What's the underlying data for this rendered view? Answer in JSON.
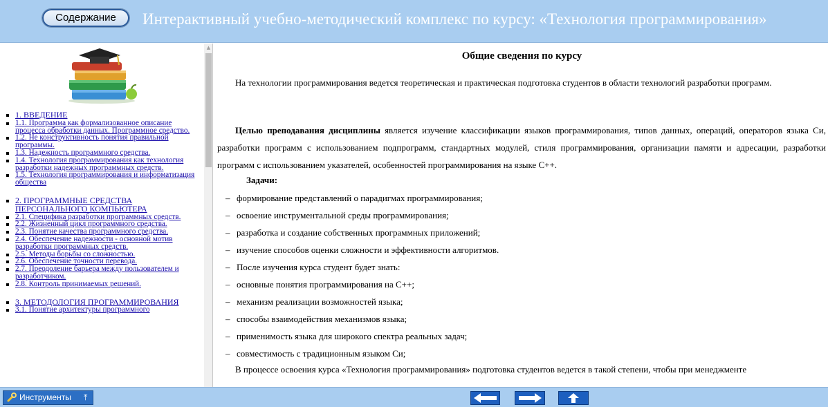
{
  "header": {
    "toc_button": "Содержание",
    "title": "Интерактивный учебно-методический комплекс по курсу: «Технология программирования»"
  },
  "sidebar": {
    "logo_icon": "books-graduation-cap-icon",
    "items": [
      {
        "label": "1. ВВЕДЕНИЕ",
        "kind": "part"
      },
      {
        "label": "1.1. Программа как формализованное описание процесса обработки данных. Программное средство."
      },
      {
        "label": "1.2. Не конструктивность понятия правильной программы."
      },
      {
        "label": "1.3. Надежность программного средства."
      },
      {
        "label": "1.4. Технология программирования как технология разработки надежных программных средств."
      },
      {
        "label": "1.5. Технология программирования и информатизация общества"
      },
      {
        "label": "2. ПРОГРАММНЫЕ СРЕДСТВА ПЕРСОНАЛЬНОГО КОМПЬЮТЕРА",
        "kind": "part"
      },
      {
        "label": "2.1. Специфика разработки программных средств."
      },
      {
        "label": "2.2. Жизненный цикл программного средства."
      },
      {
        "label": "2.3. Понятие качества программного средства."
      },
      {
        "label": "2.4. Обеспечение надежности - основной мотив разработки программных средств."
      },
      {
        "label": "2.5. Методы борьбы со сложностью."
      },
      {
        "label": "2.6. Обеспечение точности перевода."
      },
      {
        "label": "2.7. Преодоление барьера между пользователем и разработчиком."
      },
      {
        "label": "2.8. Контроль принимаемых решений."
      },
      {
        "label": "3. МЕТОДОЛОГИЯ ПРОГРАММИРОВАНИЯ",
        "kind": "part"
      },
      {
        "label": "3.1. Понятие архитектуры программного"
      }
    ]
  },
  "content": {
    "title": "Общие сведения по курсу",
    "intro": "На технологии программирования ведется теоретическая и практическая подготовка студентов в области технологий разработки программ.",
    "goal_bold": "Целью преподавания дисциплины",
    "goal_rest": " является изучение классификации языков программирования, типов данных, операций, операторов языка Си, разработки программ с использованием подпрограмм, стандартных модулей, стиля программирования, организации памяти и адресации, разработки программ с использованием указателей, особенностей программирования на языке С++.",
    "tasks_title": "Задачи:",
    "tasks": [
      "формирование представлений о парадигмах программирования;",
      "освоение инструментальной среды программирования;",
      "разработка и создание собственных программных приложений;",
      "изучение способов оценки сложности и эффективности алгоритмов.",
      "После изучения курса студент будет знать:",
      "основные понятия программирования на С++;",
      "механизм реализации возможностей языка;",
      "способы взаимодействия механизмов языка;",
      "применимость языка для широкого спектра реальных задач;",
      "совместимость с традиционным языком Си;"
    ],
    "dash": "–",
    "last_line": "В процессе освоения курса «Технология программирования» подготовка студентов ведется в такой степени, чтобы при менеджменте"
  },
  "footer": {
    "tools_label": "Инструменты",
    "tools_icon": "tools-icon",
    "pin_icon": "pin-up-icon",
    "nav": [
      "arrow-left-icon",
      "arrow-right-icon",
      "arrow-up-icon"
    ]
  },
  "colors": {
    "header_bg": "#a9cdf0",
    "link": "#1a0dab",
    "nav_button": "#1d5fbf"
  }
}
